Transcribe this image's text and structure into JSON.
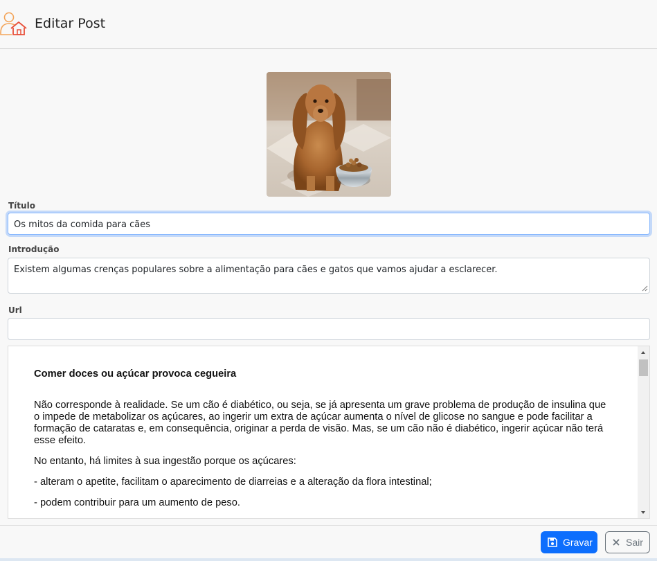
{
  "header": {
    "title": "Editar Post",
    "icon": "user-home-icon"
  },
  "post_image": {
    "alt": "dog-photo",
    "description_icon": "image"
  },
  "form": {
    "title_label": "Título",
    "title_value": "Os mitos da comida para cães",
    "intro_label": "Introdução",
    "intro_value": "Existem algumas crenças populares sobre a alimentação para cães e gatos que vamos ajudar a esclarecer.",
    "url_label": "Url",
    "url_value": ""
  },
  "editor": {
    "heading": "Comer doces ou açúcar provoca cegueira",
    "paragraphs": [
      "Não corresponde à realidade. Se um cão é diabético, ou seja, se já apresenta um grave problema de produção de insulina que o impede de metabolizar os açúcares, ao ingerir um extra de açúcar aumenta o nível de glicose no sangue e pode facilitar a formação de cataratas e, em consequência, originar a perda de visão. Mas, se um cão não é diabético, ingerir açúcar não terá esse efeito.",
      "No entanto, há limites à sua ingestão porque os açúcares:",
      "- alteram o apetite, facilitam o aparecimento de diarreias e a alteração da flora intestinal;",
      "- podem contribuir para um aumento de peso."
    ]
  },
  "footer": {
    "save_label": "Gravar",
    "exit_label": "Sair"
  },
  "colors": {
    "primary": "#0d6efd",
    "secondary": "#6c757d",
    "icon_orange": "#f07a3c"
  }
}
